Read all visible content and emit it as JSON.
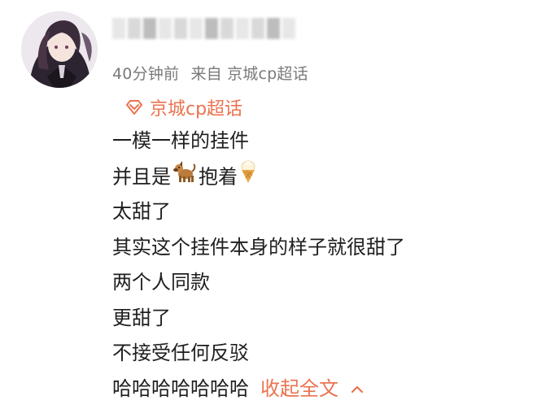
{
  "post": {
    "meta": {
      "time": "40分钟前",
      "source": "来自 京城cp超话"
    },
    "topic": {
      "label": "京城cp超话"
    },
    "lines": [
      "一模一样的挂件",
      "并且是",
      "抱着",
      "太甜了",
      "其实这个挂件本身的样子就很甜了",
      "两个人同款",
      "更甜了",
      "不接受任何反驳",
      "哈哈哈哈哈哈哈"
    ],
    "collapse_label": "收起全文"
  },
  "icons": {
    "topic": "super-topic-icon",
    "dog": "dog-emoji",
    "ice_cream": "ice-cream-emoji",
    "chevron": "chevron-up-icon"
  },
  "colors": {
    "accent": "#eb7350",
    "meta_text": "#7a7a7a",
    "body_text": "#1f1f1f"
  }
}
